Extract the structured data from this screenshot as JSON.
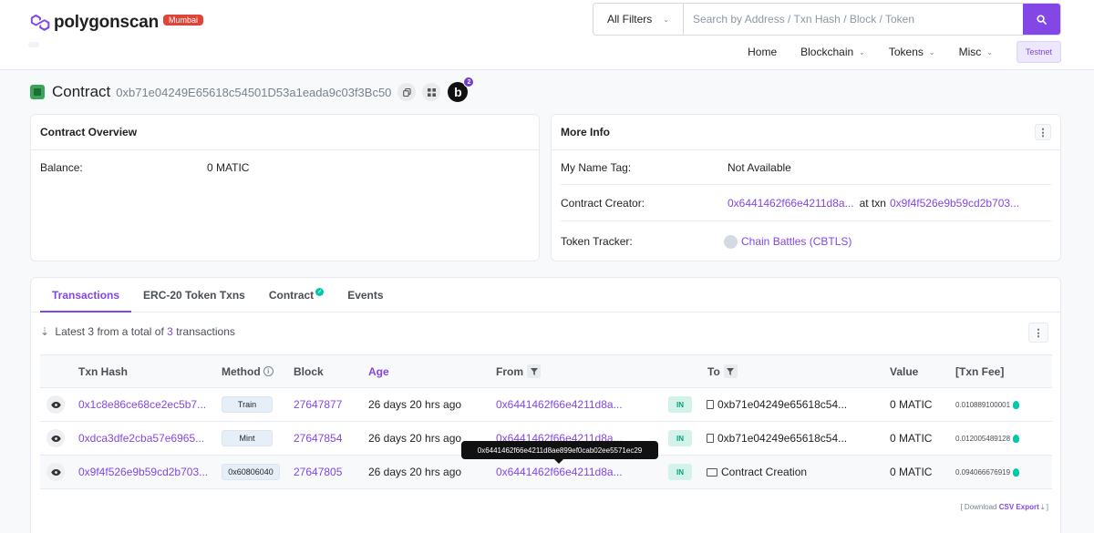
{
  "header": {
    "brand": "polygonscan",
    "network": "Mumbai",
    "filter_label": "All Filters",
    "search_placeholder": "Search by Address / Txn Hash / Block / Token",
    "nav": [
      {
        "label": "Home",
        "has_caret": false
      },
      {
        "label": "Blockchain",
        "has_caret": true
      },
      {
        "label": "Tokens",
        "has_caret": true
      },
      {
        "label": "Misc",
        "has_caret": true
      }
    ],
    "testnet_label": "Testnet"
  },
  "contract": {
    "label": "Contract",
    "address": "0xb71e04249E65618c54501D53a1eada9c03f3Bc50",
    "badge_letter": "b",
    "badge_count": "2"
  },
  "overview": {
    "title": "Contract Overview",
    "balance_label": "Balance:",
    "balance_value": "0 MATIC"
  },
  "more_info": {
    "title": "More Info",
    "name_tag_label": "My Name Tag:",
    "name_tag_value": "Not Available",
    "creator_label": "Contract Creator:",
    "creator_address": "0x6441462f66e4211d8a...",
    "creator_at": "at txn",
    "creator_txn": "0x9f4f526e9b59cd2b703...",
    "token_tracker_label": "Token Tracker:",
    "token_tracker_value": "Chain Battles (CBTLS)"
  },
  "tabs": [
    {
      "label": "Transactions",
      "active": true
    },
    {
      "label": "ERC-20 Token Txns",
      "active": false
    },
    {
      "label": "Contract",
      "active": false
    },
    {
      "label": "Events",
      "active": false
    }
  ],
  "summary": {
    "prefix": "Latest 3 from a total of",
    "count": "3",
    "suffix": "transactions"
  },
  "table": {
    "headers": {
      "txn_hash": "Txn Hash",
      "method": "Method",
      "block": "Block",
      "age": "Age",
      "from": "From",
      "to": "To",
      "value": "Value",
      "fee": "[Txn Fee]"
    },
    "rows": [
      {
        "hash": "0x1c8e86ce68ce2ec5b7...",
        "method": "Train",
        "block": "27647877",
        "age": "26 days 20 hrs ago",
        "from": "0x6441462f66e4211d8a...",
        "direction": "IN",
        "to": "0xb71e04249e65618c54...",
        "value": "0 MATIC",
        "fee": "0.010889100001"
      },
      {
        "hash": "0xdca3dfe2cba57e6965...",
        "method": "Mint",
        "block": "27647854",
        "age": "26 days 20 hrs ago",
        "from": "0x6441462f66e4211d8a...",
        "direction": "IN",
        "to": "0xb71e04249e65618c54...",
        "value": "0 MATIC",
        "fee": "0.012005489128"
      },
      {
        "hash": "0x9f4f526e9b59cd2b703...",
        "method": "0x60806040",
        "block": "27647805",
        "age": "26 days 20 hrs ago",
        "from": "0x6441462f66e4211d8a...",
        "direction": "IN",
        "to": "Contract Creation",
        "value": "0 MATIC",
        "fee": "0.094066676919"
      }
    ]
  },
  "tooltip_text": "0x6441462f66e4211d8ae899ef0cab02ee5571ec29",
  "csv": {
    "prefix": "[ Download",
    "link": "CSV Export",
    "suffix": "]"
  },
  "colors": {
    "brand": "#8247e5",
    "mumbai_badge": "#de4437",
    "in_badge": "#00a27a",
    "verified": "#00c9a7"
  }
}
